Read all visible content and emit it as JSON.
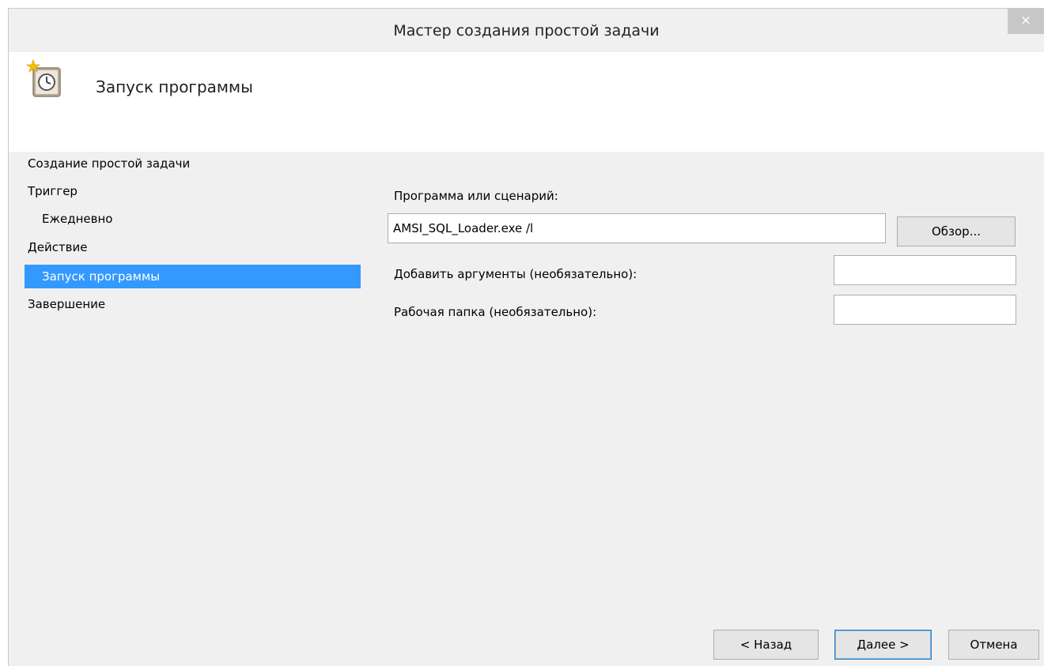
{
  "window": {
    "title": "Мастер создания простой задачи",
    "close_glyph": "×"
  },
  "header": {
    "title": "Запуск программы",
    "icon": "task-scheduler-icon"
  },
  "nav": {
    "items": [
      {
        "label": "Создание простой задачи",
        "level": 0,
        "selected": false
      },
      {
        "label": "Триггер",
        "level": 0,
        "selected": false
      },
      {
        "label": "Ежедневно",
        "level": 1,
        "selected": false
      },
      {
        "label": "Действие",
        "level": 0,
        "selected": false
      },
      {
        "label": "Запуск программы",
        "level": 1,
        "selected": true
      },
      {
        "label": "Завершение",
        "level": 0,
        "selected": false
      }
    ],
    "selected_color": "#3399ff"
  },
  "form": {
    "program_label": "Программа или сценарий:",
    "program_value": "AMSI_SQL_Loader.exe /l",
    "browse_label": "Обзор...",
    "args_label": "Добавить аргументы (необязательно):",
    "args_value": "",
    "workdir_label": "Рабочая папка (необязательно):",
    "workdir_value": ""
  },
  "footer": {
    "back_label": "< Назад",
    "next_label": "Далее >",
    "cancel_label": "Отмена"
  }
}
